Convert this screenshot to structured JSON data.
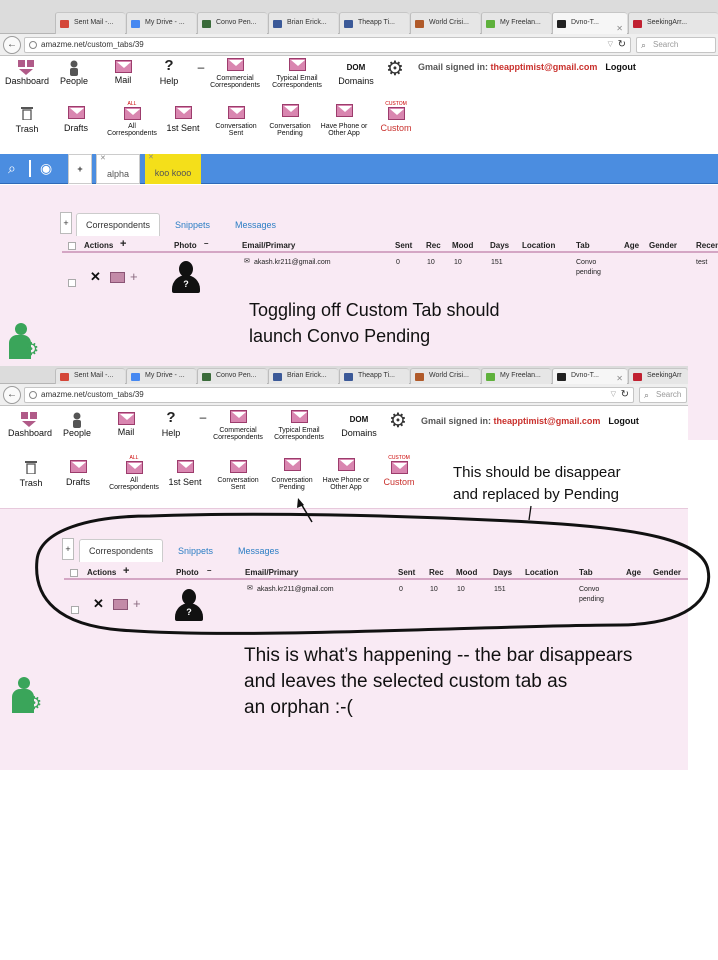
{
  "tabs": [
    {
      "label": "Sent Mail -...",
      "color": "#d44638"
    },
    {
      "label": "My Drive - ...",
      "color": "#4688f1"
    },
    {
      "label": "Convo Pen...",
      "color": "#3a6b3a"
    },
    {
      "label": "Brian Erick...",
      "color": "#3b5998"
    },
    {
      "label": "Theapp Ti...",
      "color": "#3b5998"
    },
    {
      "label": "World Crisi...",
      "color": "#b05a2a"
    },
    {
      "label": "My Freelan...",
      "color": "#5fb13c"
    },
    {
      "label": "Dvno-T...",
      "color": "#222222"
    },
    {
      "label": "SeekingArr...",
      "color": "#c02030"
    }
  ],
  "tabs2": [
    {
      "label": "Sent Mail -...",
      "color": "#d44638"
    },
    {
      "label": "My Drive - ...",
      "color": "#4688f1"
    },
    {
      "label": "Convo Pen...",
      "color": "#3a6b3a"
    },
    {
      "label": "Brian Erick...",
      "color": "#3b5998"
    },
    {
      "label": "Theapp Ti...",
      "color": "#3b5998"
    },
    {
      "label": "World Crisi...",
      "color": "#b05a2a"
    },
    {
      "label": "My Freelan...",
      "color": "#5fb13c"
    },
    {
      "label": "Dvno-T...",
      "color": "#222222"
    },
    {
      "label": "SeekingArr",
      "color": "#c02030"
    }
  ],
  "url": "amazme.net/custom_tabs/39",
  "search_placeholder": "Search",
  "nav_row1": {
    "dashboard": "Dashboard",
    "people": "People",
    "mail": "Mail",
    "help": "Help",
    "dash_sep": "–",
    "commercial": "Commercial Correspondents",
    "typical": "Typical Email Correspondents",
    "dom_top": "DOM",
    "domains": "Domains"
  },
  "nav_row2": {
    "trash": "Trash",
    "drafts": "Drafts",
    "all_tag": "ALL",
    "all": "All Correspondents",
    "first_sent": "1st Sent",
    "conv_sent": "Conversation Sent",
    "conv_pending": "Conversation Pending",
    "phone": "Have Phone or Other App",
    "custom_tag": "CUSTOM",
    "custom": "Custom"
  },
  "gmail": {
    "prefix": "Gmail signed in:",
    "email": "theapptimist@gmail.com",
    "logout": "Logout"
  },
  "filter_tabs": {
    "plus": "+",
    "alpha": "alpha",
    "koo": "koo kooo"
  },
  "subtabs": {
    "plus": "+",
    "correspondents": "Correspondents",
    "snippets": "Snippets",
    "messages": "Messages"
  },
  "columns": {
    "actions": "Actions",
    "photo": "Photo",
    "photo_minus": "–",
    "email": "Email/Primary",
    "sent": "Sent",
    "rec": "Rec",
    "mood": "Mood",
    "days": "Days",
    "location": "Location",
    "tab": "Tab",
    "age": "Age",
    "gender": "Gender",
    "recent": "Recen"
  },
  "row": {
    "email": "akash.kr211@gmail.com",
    "sent": "0",
    "rec": "10",
    "mood": "10",
    "days": "151",
    "tab_line1": "Convo",
    "tab_line2": "pending",
    "recent": "test"
  },
  "annotations": {
    "a1_line1": "Toggling off Custom Tab should",
    "a1_line2": "launch Convo Pending",
    "a2_line1": "This should be disappear",
    "a2_line2": "and replaced by Pending",
    "a3_line1": "This is what’s happening -- the bar disappears",
    "a3_line2": "and leaves the selected custom tab as",
    "a3_line3": "an orphan :-("
  },
  "colors": {
    "blue_bar": "#4b8de0",
    "pink_bg": "#f9eaf4",
    "yellow_tab": "#f4df1a",
    "email_red": "#c9302c"
  }
}
